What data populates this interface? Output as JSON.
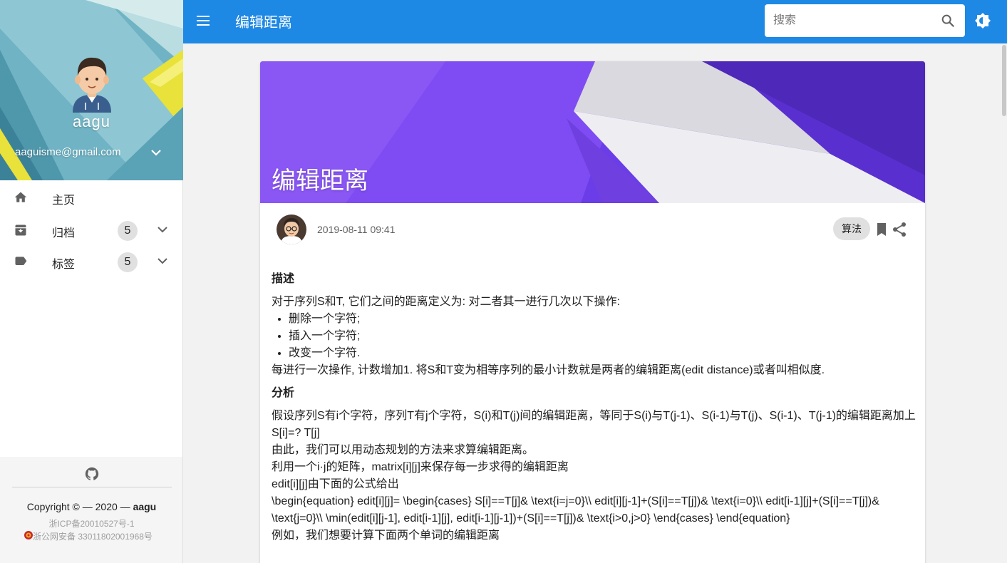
{
  "app": {
    "title": "编辑距离"
  },
  "sidebar": {
    "user_name": "aagu",
    "email": "aaguisme@gmail.com",
    "items": [
      {
        "label": "主页",
        "icon": "home-icon"
      },
      {
        "label": "归档",
        "icon": "archive-icon",
        "count": "5"
      },
      {
        "label": "标签",
        "icon": "label-icon",
        "count": "5"
      }
    ],
    "footer": {
      "copyright_prefix": "Copyright © — 2020 — ",
      "copyright_owner": "aagu",
      "icp": "浙ICP备20010527号-1",
      "police": "浙公网安备 33011802001968号"
    }
  },
  "search": {
    "placeholder": "搜索",
    "value": ""
  },
  "post": {
    "title": "编辑距离",
    "date": "2019-08-11 09:41",
    "tag": "算法",
    "section1_title": "描述",
    "intro": "对于序列S和T, 它们之间的距离定义为: 对二者其一进行几次以下操作:",
    "operations": [
      "删除一个字符;",
      "插入一个字符;",
      "改变一个字符."
    ],
    "summary": "每进行一次操作, 计数增加1. 将S和T变为相等序列的最小计数就是两者的编辑距离(edit distance)或者叫相似度.",
    "section2_title": "分析",
    "analysis_1": "假设序列S有i个字符，序列T有j个字符，S(i)和T(j)间的编辑距离，等同于S(i)与T(j-1)、S(i-1)与T(j)、S(i-1)、T(j-1)的编辑距离加上S[i]=? T[j]",
    "analysis_2": "由此，我们可以用动态规划的方法来求算编辑距离。",
    "analysis_3": "利用一个i·j的矩阵，matrix[i][j]来保存每一步求得的编辑距离",
    "analysis_4": "edit[i][j]由下面的公式给出",
    "formula": "\\begin{equation} edit[i][j]= \\begin{cases} S[i]==T[j]& \\text{i=j=0}\\\\ edit[i][j-1]+(S[i]==T[j])& \\text{i=0}\\\\ edit[i-1][j]+(S[i]==T[j])& \\text{j=0}\\\\ \\min(edit[i][j-1], edit[i-1][j], edit[i-1][j-1])+(S[i]==T[j])& \\text{i>0,j>0} \\end{cases} \\end{equation}",
    "example": "例如，我们想要计算下面两个单词的编辑距离"
  },
  "colors": {
    "primary": "#1e88e5",
    "hero": "#6a3de8"
  }
}
